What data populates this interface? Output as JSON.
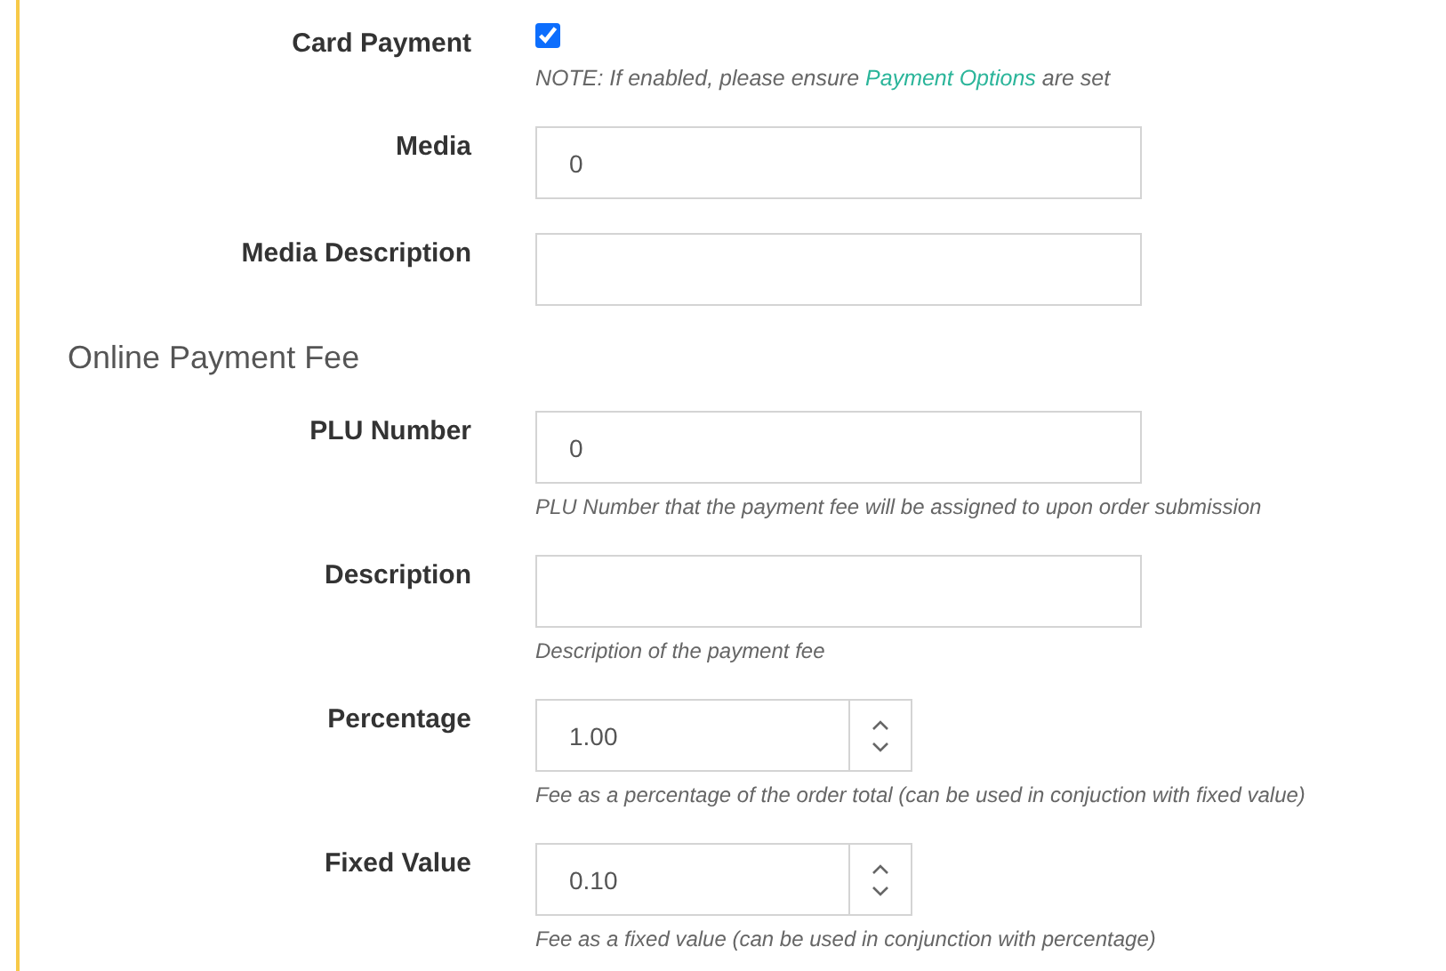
{
  "fields": [
    {
      "kind": "checkbox",
      "label": "Card Payment",
      "checked": true,
      "note": {
        "before": "NOTE: If enabled, please ensure ",
        "link": "Payment Options",
        "after": " are set"
      }
    },
    {
      "kind": "text",
      "label": "Media",
      "value": "0"
    },
    {
      "kind": "text",
      "label": "Media Description"
    }
  ],
  "section": {
    "title": "Online Payment Fee",
    "fields": [
      {
        "kind": "text",
        "label": "PLU Number",
        "value": "0",
        "help": "PLU Number that the payment fee will be assigned to upon order submission"
      },
      {
        "kind": "text",
        "label": "Description",
        "help": "Description of the payment fee"
      },
      {
        "kind": "number",
        "label": "Percentage",
        "value": "1.00",
        "help": "Fee as a percentage of the order total (can be used in conjuction with fixed value)"
      },
      {
        "kind": "number",
        "label": "Fixed Value",
        "value": "0.10",
        "help": "Fee as a fixed value (can be used in conjunction with percentage)"
      }
    ]
  }
}
